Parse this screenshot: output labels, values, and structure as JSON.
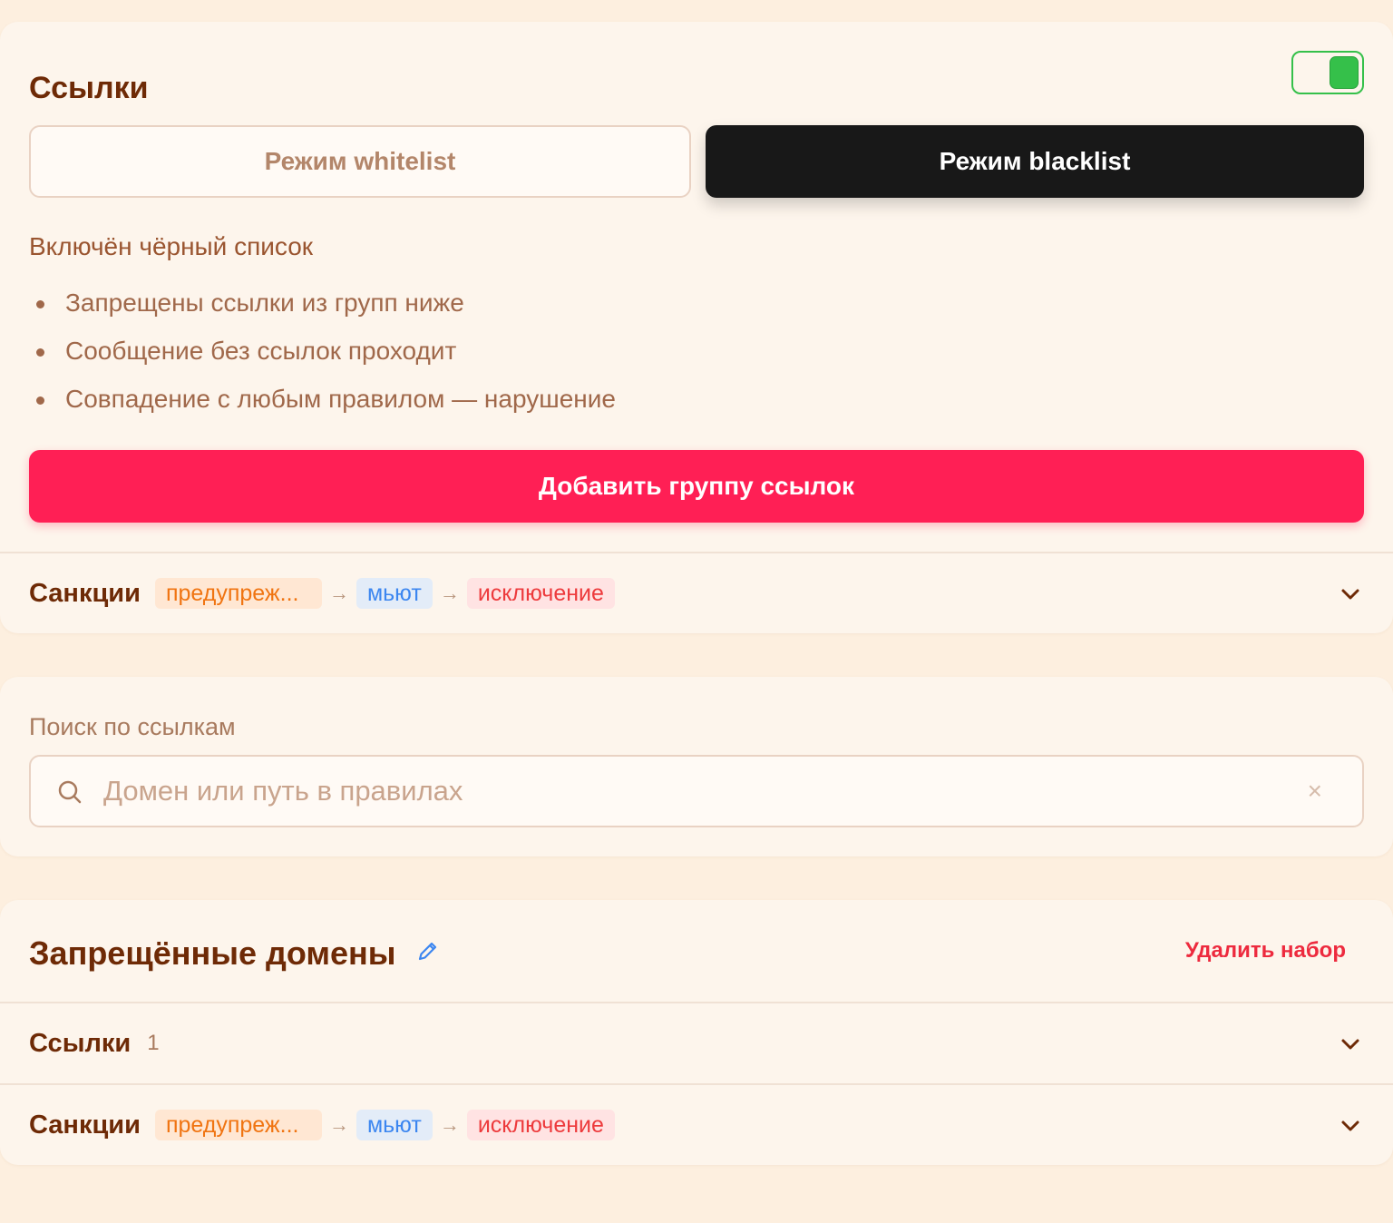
{
  "links_card": {
    "title": "Ссылки",
    "toggle_state": "on",
    "modes": {
      "whitelist": "Режим whitelist",
      "blacklist": "Режим blacklist",
      "active": "blacklist"
    },
    "description_title": "Включён чёрный список",
    "bullets": [
      "Запрещены ссылки из групп ниже",
      "Сообщение без ссылок проходит",
      "Совпадение с любым правилом — нарушение"
    ],
    "add_button": "Добавить группу ссылок",
    "sanctions": {
      "label": "Санкции",
      "steps": [
        "предупреж...",
        "мьют",
        "исключение"
      ]
    }
  },
  "search_card": {
    "label": "Поиск по ссылкам",
    "placeholder": "Домен или путь в правилах",
    "value": "",
    "clear_icon": "×"
  },
  "domains_card": {
    "title": "Запрещённые домены",
    "delete_label": "Удалить набор",
    "links_row": {
      "label": "Ссылки",
      "count": "1"
    },
    "sanctions": {
      "label": "Санкции",
      "steps": [
        "предупреж...",
        "мьют",
        "исключение"
      ]
    }
  },
  "colors": {
    "accent": "#ff1f55",
    "toggle_on": "#35c04a",
    "warn": "#f07411",
    "mute": "#3c86f0",
    "kick": "#ed3a3c"
  },
  "icons": [
    "chevron-down-icon",
    "search-icon",
    "clear-icon",
    "pencil-icon",
    "arrow-right-icon"
  ]
}
